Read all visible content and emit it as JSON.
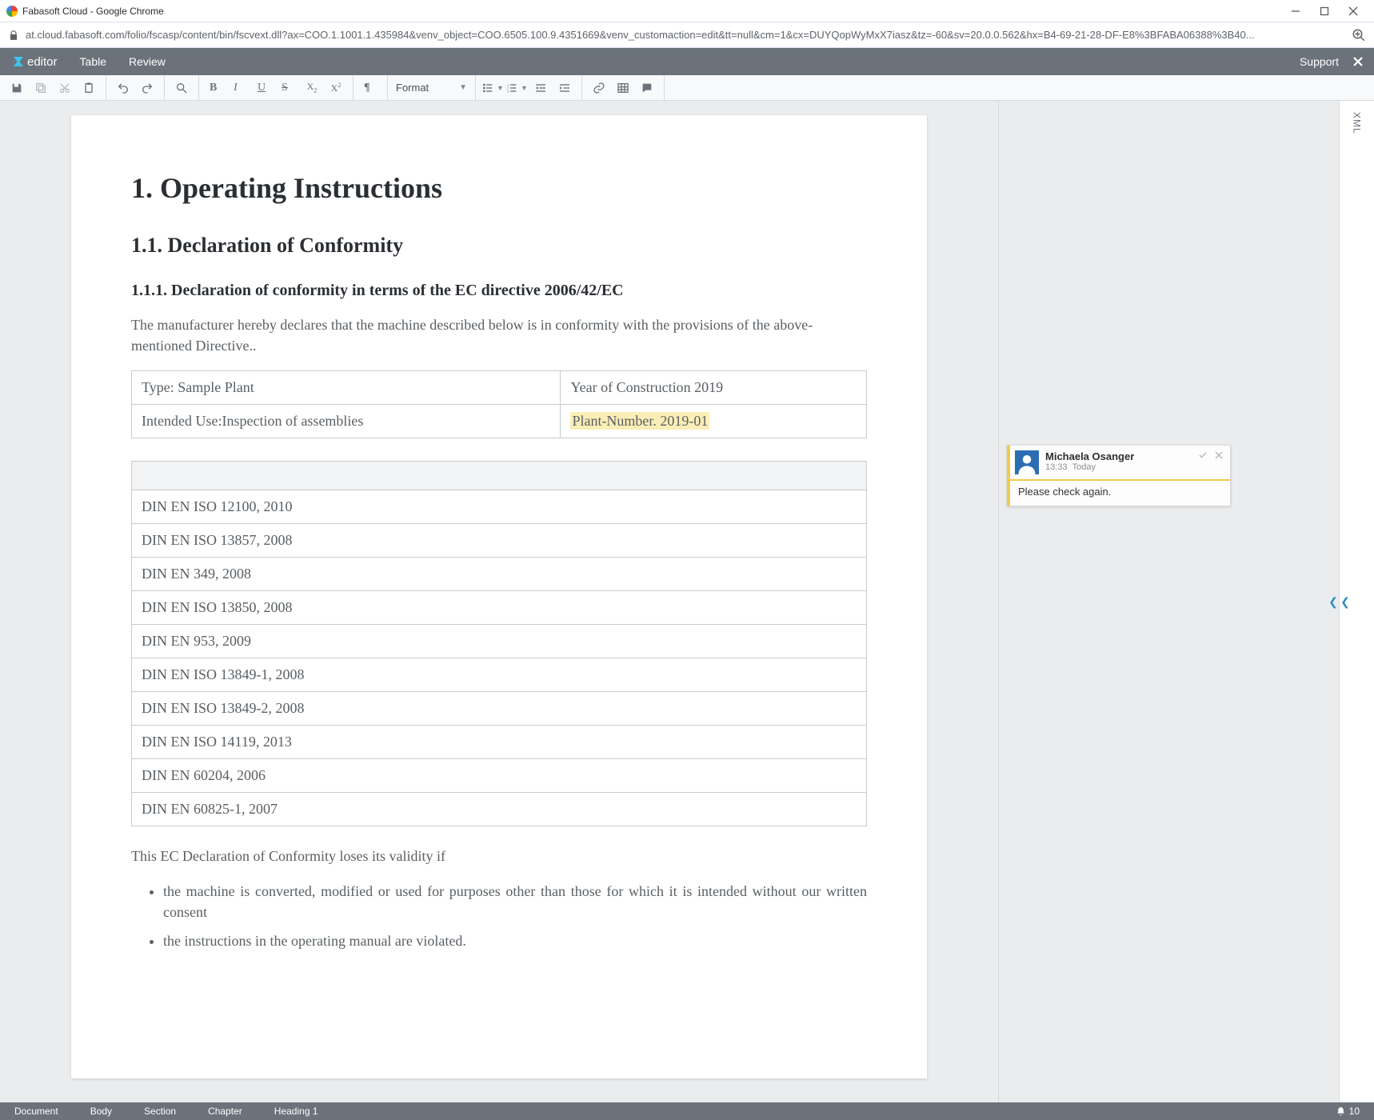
{
  "browser": {
    "title": "Fabasoft Cloud - Google Chrome",
    "url": "at.cloud.fabasoft.com/folio/fscasp/content/bin/fscvext.dll?ax=COO.1.1001.1.435984&venv_object=COO.6505.100.9.4351669&venv_customaction=edit&tt=null&cm=1&cx=DUYQopWyMxX7iasz&tz=-60&sv=20.0.0.562&hx=B4-69-21-28-DF-E8%3BFABA06388%3B40..."
  },
  "appheader": {
    "logo_text": "editor",
    "menus": [
      "Table",
      "Review"
    ],
    "support": "Support"
  },
  "toolbar": {
    "format_label": "Format"
  },
  "document": {
    "h1": "1. Operating Instructions",
    "h2": "1.1. Declaration of Conformity",
    "h3": "1.1.1. Declaration of conformity in terms of the EC directive 2006/42/EC",
    "intro": "The manufacturer hereby declares that the machine described below is in conformity with the provisions of the above-mentioned Directive..",
    "info_table": {
      "r1c1": "Type: Sample Plant",
      "r1c2": "Year of Construction 2019",
      "r2c1": "Intended Use:Inspection of assemblies",
      "r2c2": "Plant-Number. 2019-01"
    },
    "standards": [
      "DIN EN ISO 12100, 2010",
      "DIN EN ISO 13857, 2008",
      "DIN EN 349, 2008",
      "DIN EN ISO 13850, 2008",
      "DIN EN 953, 2009",
      "DIN EN ISO 13849-1, 2008",
      "DIN EN ISO 13849-2, 2008",
      "DIN EN ISO 14119, 2013",
      "DIN EN 60204, 2006",
      "DIN EN 60825-1, 2007"
    ],
    "validity_intro": "This EC Declaration of Conformity loses its validity if",
    "validity_bullets": [
      "the machine is converted, modified or used for purposes other than those for which it is intended without our written consent",
      "the instructions in the operating manual are violated."
    ]
  },
  "comment": {
    "author": "Michaela Osanger",
    "time": "13:33",
    "day": "Today",
    "text": "Please check again."
  },
  "sidepanel": {
    "xml_label": "XML"
  },
  "statusbar": {
    "crumbs": [
      "Document",
      "Body",
      "Section",
      "Chapter",
      "Heading 1"
    ],
    "notif_count": "10"
  }
}
